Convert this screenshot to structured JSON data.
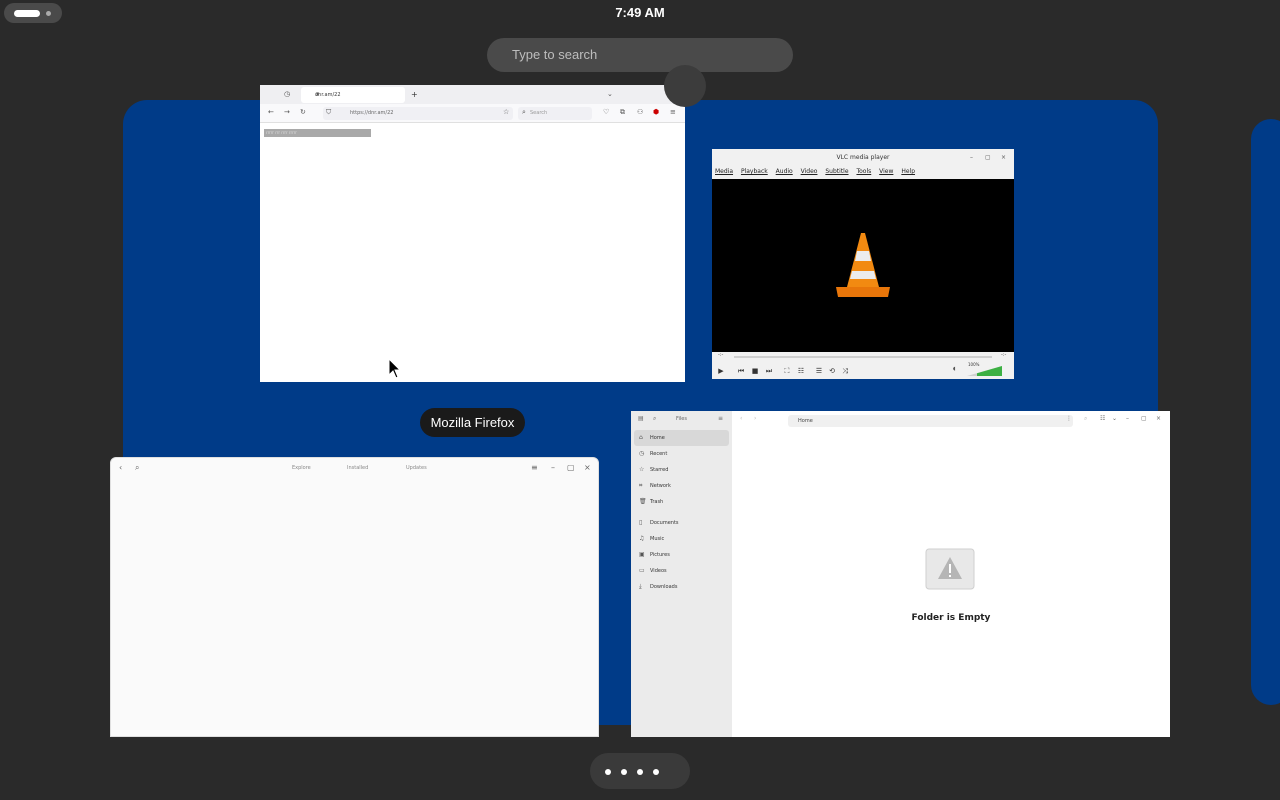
{
  "topbar": {
    "clock": "7:49 AM"
  },
  "search": {
    "placeholder": "Type to search"
  },
  "windows": {
    "firefox": {
      "title": "Mozilla Firefox",
      "tab_label": "dnr.am/22",
      "url": "https://dnr.am/22",
      "search_placeholder": "Search",
      "highlighted_text": "rrrrr rrr rrrr rrrrr"
    },
    "vlc": {
      "title": "VLC media player",
      "menu": [
        "Media",
        "Playback",
        "Audio",
        "Video",
        "Subtitle",
        "Tools",
        "View",
        "Help"
      ],
      "time_left": "-:-",
      "time_right": "-:-",
      "volume": "100%"
    },
    "software": {
      "tabs": [
        "Explore",
        "Installed",
        "Updates"
      ]
    },
    "files": {
      "app_label": "Files",
      "path": "Home",
      "sidebar": [
        "Home",
        "Recent",
        "Starred",
        "Network",
        "Trash",
        "Documents",
        "Music",
        "Pictures",
        "Videos",
        "Downloads"
      ],
      "empty_message": "Folder is Empty"
    }
  },
  "colors": {
    "workspace": "#003b88",
    "background": "#2a2a2a"
  }
}
